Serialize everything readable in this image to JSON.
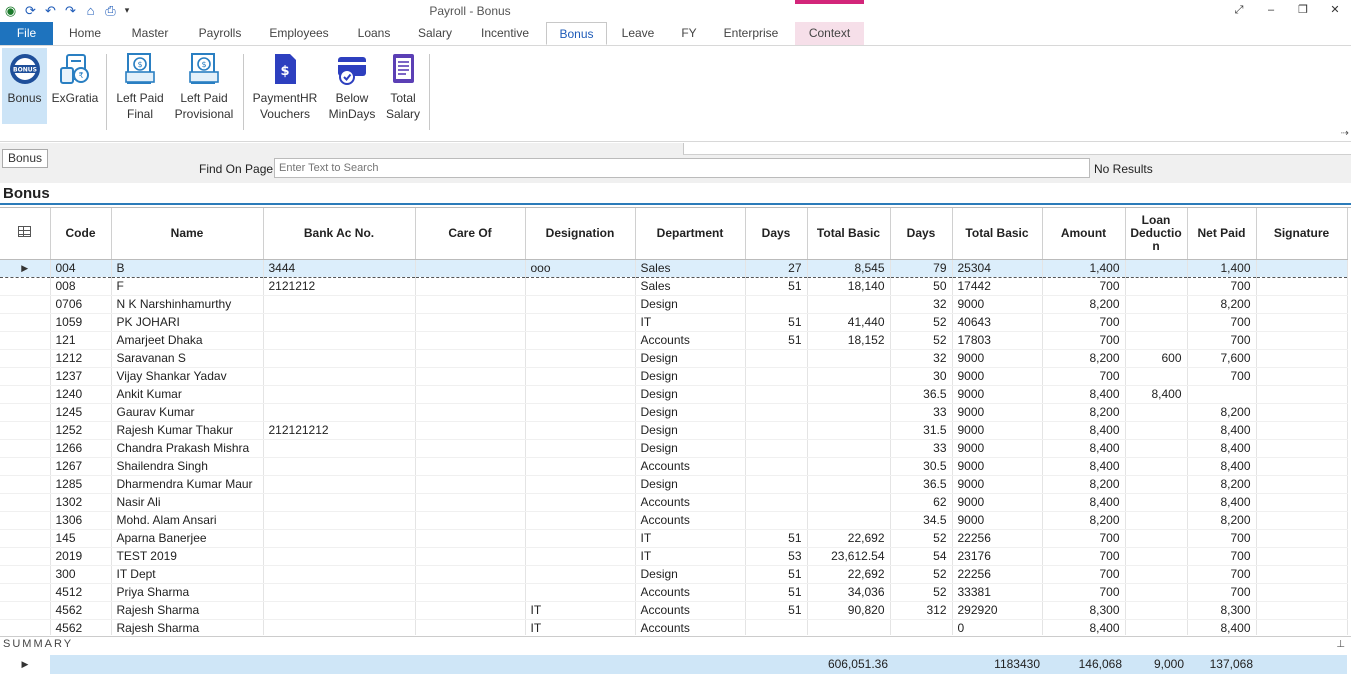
{
  "window": {
    "title": "Payroll - Bonus"
  },
  "qat_icons": [
    "app-logo-icon",
    "refresh-icon",
    "undo-icon",
    "redo-icon",
    "home-icon",
    "print-icon",
    "dropdown-arrow-icon"
  ],
  "winctl": {
    "restore": "⤢",
    "minimize": "–",
    "maximize": "❐",
    "close": "✕"
  },
  "tabs": [
    {
      "label": "File"
    },
    {
      "label": "Home"
    },
    {
      "label": "Master"
    },
    {
      "label": "Payrolls"
    },
    {
      "label": "Employees"
    },
    {
      "label": "Loans"
    },
    {
      "label": "Salary"
    },
    {
      "label": "Incentive"
    },
    {
      "label": "Bonus"
    },
    {
      "label": "Leave"
    },
    {
      "label": "FY"
    },
    {
      "label": "Enterprise"
    },
    {
      "label": "Context"
    }
  ],
  "ribbon": {
    "buttons": [
      {
        "l1": "Bonus",
        "l2": ""
      },
      {
        "l1": "ExGratia",
        "l2": ""
      },
      {
        "l1": "Left Paid",
        "l2": "Final"
      },
      {
        "l1": "Left Paid",
        "l2": "Provisional"
      },
      {
        "l1": "PaymentHR",
        "l2": "Vouchers"
      },
      {
        "l1": "Below",
        "l2": "MinDays"
      },
      {
        "l1": "Total",
        "l2": "Salary"
      }
    ]
  },
  "findbar": {
    "chip": "Bonus",
    "label": "Find On Page",
    "placeholder": "Enter Text to Search",
    "result": "No Results"
  },
  "section_title": "Bonus",
  "table": {
    "headers": [
      "Code",
      "Name",
      "Bank Ac No.",
      "Care Of",
      "Designation",
      "Department",
      "Days",
      "Total Basic",
      "Days",
      "Total Basic",
      "Amount",
      "Loan Deductio n",
      "Net Paid",
      "Signature"
    ],
    "rows": [
      [
        "004",
        "B",
        "3444",
        "",
        "ooo",
        "Sales",
        "27",
        "8,545",
        "79",
        "25304",
        "1,400",
        "",
        "1,400",
        ""
      ],
      [
        "008",
        "F",
        "2121212",
        "",
        "",
        "Sales",
        "51",
        "18,140",
        "50",
        "17442",
        "700",
        "",
        "700",
        ""
      ],
      [
        "0706",
        "N K Narshinhamurthy",
        "",
        "",
        "",
        "Design",
        "",
        "",
        "32",
        "9000",
        "8,200",
        "",
        "8,200",
        ""
      ],
      [
        "1059",
        "PK JOHARI",
        "",
        "",
        "",
        "IT",
        "51",
        "41,440",
        "52",
        "40643",
        "700",
        "",
        "700",
        ""
      ],
      [
        "121",
        "Amarjeet Dhaka",
        "",
        "",
        "",
        "Accounts",
        "51",
        "18,152",
        "52",
        "17803",
        "700",
        "",
        "700",
        ""
      ],
      [
        "1212",
        "Saravanan S",
        "",
        "",
        "",
        "Design",
        "",
        "",
        "32",
        "9000",
        "8,200",
        "600",
        "7,600",
        ""
      ],
      [
        "1237",
        "Vijay  Shankar Yadav",
        "",
        "",
        "",
        "Design",
        "",
        "",
        "30",
        "9000",
        "700",
        "",
        "700",
        ""
      ],
      [
        "1240",
        "Ankit Kumar",
        "",
        "",
        "",
        "Design",
        "",
        "",
        "36.5",
        "9000",
        "8,400",
        "8,400",
        "",
        ""
      ],
      [
        "1245",
        "Gaurav Kumar",
        "",
        "",
        "",
        "Design",
        "",
        "",
        "33",
        "9000",
        "8,200",
        "",
        "8,200",
        ""
      ],
      [
        "1252",
        "Rajesh Kumar Thakur",
        "212121212",
        "",
        "",
        "Design",
        "",
        "",
        "31.5",
        "9000",
        "8,400",
        "",
        "8,400",
        ""
      ],
      [
        "1266",
        "Chandra Prakash Mishra",
        "",
        "",
        "",
        "Design",
        "",
        "",
        "33",
        "9000",
        "8,400",
        "",
        "8,400",
        ""
      ],
      [
        "1267",
        "Shailendra Singh",
        "",
        "",
        "",
        "Accounts",
        "",
        "",
        "30.5",
        "9000",
        "8,400",
        "",
        "8,400",
        ""
      ],
      [
        "1285",
        "Dharmendra Kumar Maur",
        "",
        "",
        "",
        "Design",
        "",
        "",
        "36.5",
        "9000",
        "8,200",
        "",
        "8,200",
        ""
      ],
      [
        "1302",
        "Nasir Ali",
        "",
        "",
        "",
        "Accounts",
        "",
        "",
        "62",
        "9000",
        "8,400",
        "",
        "8,400",
        ""
      ],
      [
        "1306",
        "Mohd.  Alam Ansari",
        "",
        "",
        "",
        "Accounts",
        "",
        "",
        "34.5",
        "9000",
        "8,200",
        "",
        "8,200",
        ""
      ],
      [
        "145",
        "Aparna Banerjee",
        "",
        "",
        "",
        "IT",
        "51",
        "22,692",
        "52",
        "22256",
        "700",
        "",
        "700",
        ""
      ],
      [
        "2019",
        "TEST 2019",
        "",
        "",
        "",
        "IT",
        "53",
        "23,612.54",
        "54",
        "23176",
        "700",
        "",
        "700",
        ""
      ],
      [
        "300",
        "IT Dept",
        "",
        "",
        "",
        "Design",
        "51",
        "22,692",
        "52",
        "22256",
        "700",
        "",
        "700",
        ""
      ],
      [
        "4512",
        "Priya Sharma",
        "",
        "",
        "",
        "Accounts",
        "51",
        "34,036",
        "52",
        "33381",
        "700",
        "",
        "700",
        ""
      ],
      [
        "4562",
        "Rajesh Sharma",
        "",
        "",
        "IT",
        "Accounts",
        "51",
        "90,820",
        "312",
        "292920",
        "8,300",
        "",
        "8,300",
        ""
      ],
      [
        "4562",
        "Rajesh Sharma",
        "",
        "",
        "IT",
        "Accounts",
        "",
        "",
        "",
        "0",
        "8,400",
        "",
        "8,400",
        ""
      ]
    ]
  },
  "summary": {
    "label": "SUMMARY",
    "total_basic_1": "606,051.36",
    "total_basic_2": "1183430",
    "amount": "146,068",
    "loan_deduction": "9,000",
    "net_paid": "137,068"
  }
}
